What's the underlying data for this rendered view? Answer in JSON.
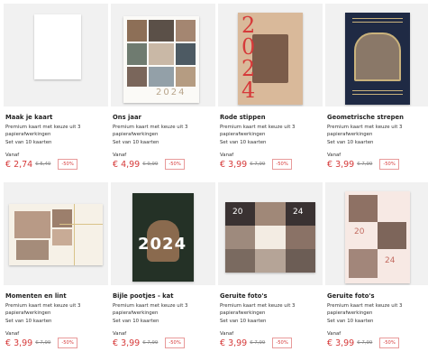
{
  "products": [
    {
      "title": "Maak je kaart",
      "desc": "Premium kaart met keuze uit 3 papierafwerkingen",
      "set": "Set van 10 kaarten",
      "from": "Vanaf",
      "price": "€ 2,74",
      "old_price": "€ 5,49",
      "discount": "-50%"
    },
    {
      "title": "Ons jaar",
      "desc": "Premium kaart met keuze uit 3 papierafwerkingen",
      "set": "Set van 10 kaarten",
      "from": "Vanaf",
      "price": "€ 4,99",
      "old_price": "€ 9,99",
      "discount": "-50%",
      "art_text": "2024"
    },
    {
      "title": "Rode stippen",
      "desc": "Premium kaart met keuze uit 3 papierafwerkingen",
      "set": "Set van 10 kaarten",
      "from": "Vanaf",
      "price": "€ 3,99",
      "old_price": "€ 7,99",
      "discount": "-50%",
      "art_text": "2024"
    },
    {
      "title": "Geometrische strepen",
      "desc": "Premium kaart met keuze uit 3 papierafwerkingen",
      "set": "Set van 10 kaarten",
      "from": "Vanaf",
      "price": "€ 3,99",
      "old_price": "€ 7,99",
      "discount": "-50%"
    },
    {
      "title": "Momenten en lint",
      "desc": "Premium kaart met keuze uit 3 papierafwerkingen",
      "set": "Set van 10 kaarten",
      "from": "Vanaf",
      "price": "€ 3,99",
      "old_price": "€ 7,99",
      "discount": "-50%"
    },
    {
      "title": "Bijle pootjes - kat",
      "desc": "Premium kaart met keuze uit 3 papierafwerkingen",
      "set": "Set van 10 kaarten",
      "from": "Vanaf",
      "price": "€ 3,99",
      "old_price": "€ 7,99",
      "discount": "-50%",
      "art_text": "2024"
    },
    {
      "title": "Geruite foto's",
      "desc": "Premium kaart met keuze uit 3 papierafwerkingen",
      "set": "Set van 10 kaarten",
      "from": "Vanaf",
      "price": "€ 3,99",
      "old_price": "€ 7,99",
      "discount": "-50%",
      "art_text": [
        "20",
        "24"
      ]
    },
    {
      "title": "Geruite foto's",
      "desc": "Premium kaart met keuze uit 3 papierafwerkingen",
      "set": "Set van 10 kaarten",
      "from": "Vanaf",
      "price": "€ 3,99",
      "old_price": "€ 7,99",
      "discount": "-50%",
      "art_text": [
        "20",
        "24"
      ]
    }
  ],
  "colors": {
    "price": "#d63a3a",
    "tile_bg": "#f1f1f1",
    "navy": "#1f2a44",
    "kraft": "#d9b99a",
    "dark": "#3a3232"
  }
}
